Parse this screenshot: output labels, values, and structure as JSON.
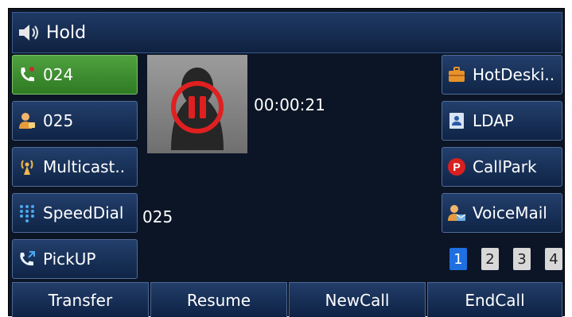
{
  "header": {
    "title": "Hold",
    "icon": "speaker-icon"
  },
  "call": {
    "timer": "00:00:21",
    "number": "025"
  },
  "left_keys": [
    {
      "label": "024",
      "icon": "phone-line-icon",
      "active": true
    },
    {
      "label": "025",
      "icon": "contact-icon",
      "active": false
    },
    {
      "label": "Multicast..",
      "icon": "antenna-icon",
      "active": false
    },
    {
      "label": "SpeedDial",
      "icon": "keypad-icon",
      "active": false
    },
    {
      "label": "PickUP",
      "icon": "phone-pickup-icon",
      "active": false
    }
  ],
  "right_keys": [
    {
      "label": "HotDeski..",
      "icon": "briefcase-icon"
    },
    {
      "label": "LDAP",
      "icon": "directory-icon"
    },
    {
      "label": "CallPark",
      "icon": "park-icon"
    },
    {
      "label": "VoiceMail",
      "icon": "voicemail-icon"
    }
  ],
  "pages": [
    "1",
    "2",
    "3",
    "4"
  ],
  "current_page": "1",
  "softkeys": [
    "Transfer",
    "Resume",
    "NewCall",
    "EndCall"
  ],
  "colors": {
    "screen_bg": "#0b1526",
    "active_line": "#4fa23e",
    "hold_ring": "#e02020",
    "page_current": "#1f6fe0"
  }
}
